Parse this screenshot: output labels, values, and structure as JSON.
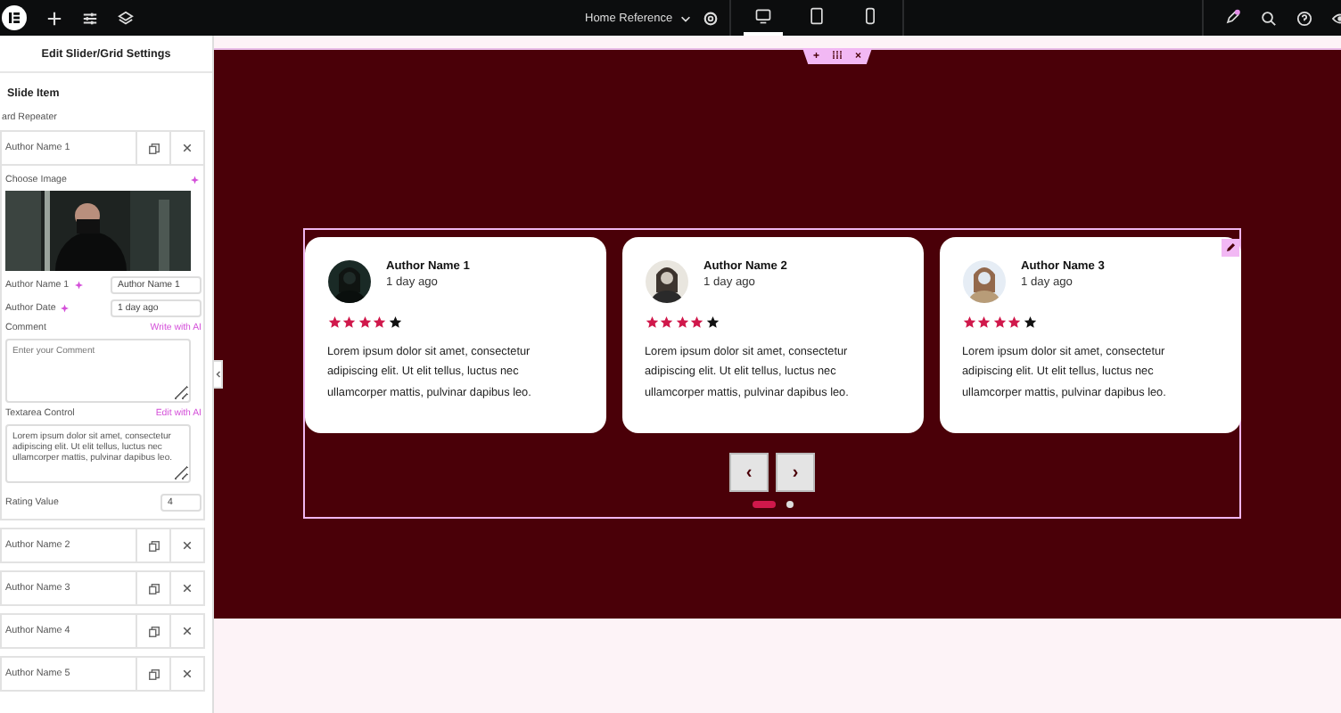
{
  "topbar": {
    "page_title": "Home Reference",
    "devices": [
      {
        "kind": "desktop",
        "selected": true
      },
      {
        "kind": "tablet",
        "selected": false
      },
      {
        "kind": "mobile",
        "selected": false
      }
    ]
  },
  "panel": {
    "title": "Edit Slider/Grid Settings",
    "section": "Slide Item",
    "repeater_label": "ard Repeater",
    "open_item": {
      "title": "Author Name 1",
      "image_label": "Choose Image",
      "fields": [
        {
          "label": "Author Name 1",
          "value": "Author Name 1"
        },
        {
          "label": "Author Date",
          "value": "1 day ago"
        }
      ],
      "comment": {
        "label": "Comment",
        "ai_link": "Write with AI",
        "placeholder": "Enter your Comment"
      },
      "textarea": {
        "label": "Textarea Control",
        "ai_link": "Edit with AI",
        "value": "Lorem ipsum dolor sit amet, consectetur adipiscing elit. Ut elit tellus, luctus nec ullamcorper mattis, pulvinar dapibus leo."
      },
      "rating": {
        "label": "Rating Value",
        "value": "4"
      }
    },
    "items": [
      "Author Name 2",
      "Author Name 3",
      "Author Name 4",
      "Author Name 5"
    ]
  },
  "handle": {
    "add": "+",
    "drag": "⁞⁞⁞",
    "close": "×"
  },
  "cards": [
    {
      "name": "Author Name 1",
      "date": "1 day ago",
      "stars": 4,
      "text": "Lorem ipsum dolor sit amet, consectetur adipiscing elit. Ut elit tellus, luctus nec ullamcorper mattis, pulvinar dapibus leo."
    },
    {
      "name": "Author Name 2",
      "date": "1 day ago",
      "stars": 4,
      "text": "Lorem ipsum dolor sit amet, consectetur adipiscing elit. Ut elit tellus, luctus nec ullamcorper mattis, pulvinar dapibus leo."
    },
    {
      "name": "Author Name 3",
      "date": "1 day ago",
      "stars": 4,
      "text": "Lorem ipsum dolor sit amet, consectetur adipiscing elit. Ut elit tellus, luctus nec ullamcorper mattis, pulvinar dapibus leo."
    }
  ],
  "nav": {
    "prev": "‹",
    "next": "›"
  },
  "dots": [
    {
      "selected": true
    },
    {
      "selected": false
    }
  ]
}
